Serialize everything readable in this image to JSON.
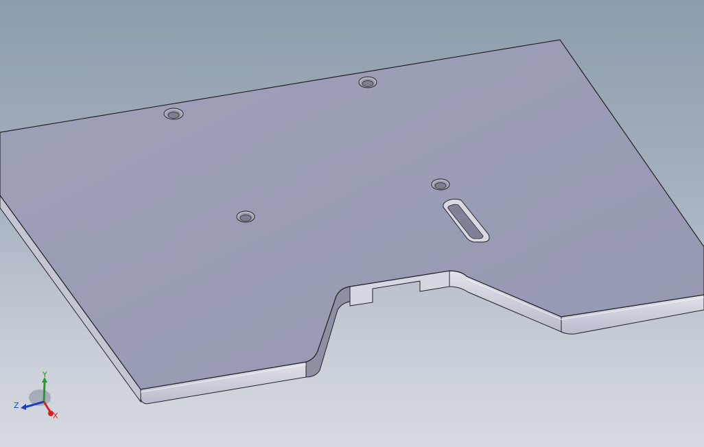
{
  "colors": {
    "background_top": "#8e9cad",
    "background_bottom": "#d6dae2",
    "plate_top": "#9a9eb4",
    "plate_side": "#c9cbd8",
    "plate_edge": "#1f2026",
    "axis_x": "#d61f1f",
    "axis_y": "#1f9e2a",
    "axis_z": "#1d3fc7"
  },
  "triad": {
    "x_label": "X",
    "y_label": "Y",
    "z_label": "Z"
  }
}
